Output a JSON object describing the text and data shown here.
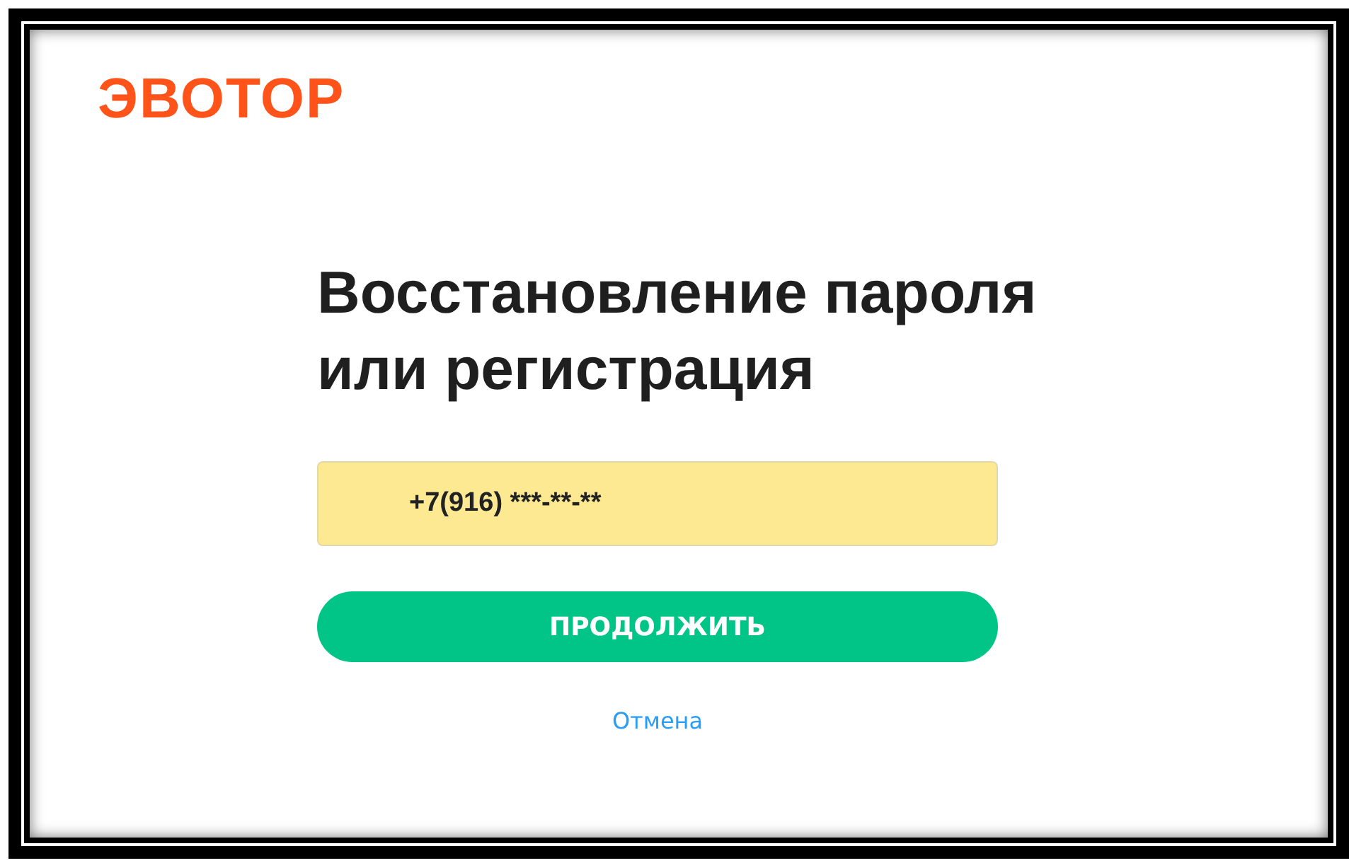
{
  "logo": "ЭВОТОР",
  "heading": {
    "lines": [
      "Восстановление пароля",
      "или регистрация"
    ]
  },
  "phone_field": {
    "value": "+7(916) ***-**-**",
    "autofilled": true
  },
  "buttons": [
    {
      "kind": "primary",
      "label": "ПРОДОЛЖИТЬ"
    },
    {
      "kind": "link",
      "label": "Отмена"
    }
  ]
}
